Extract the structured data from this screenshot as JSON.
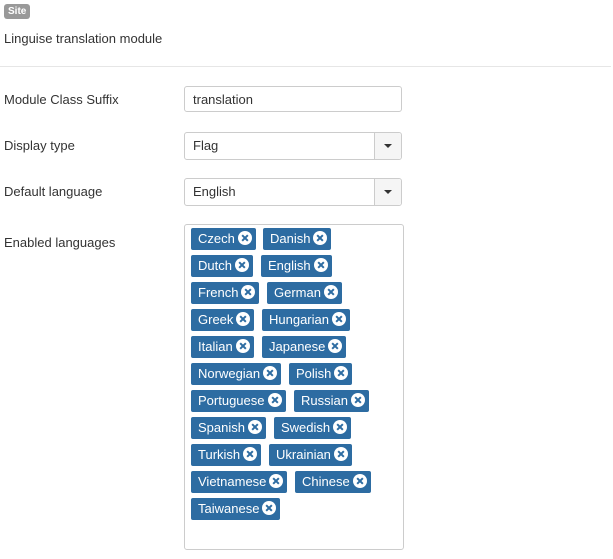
{
  "module": {
    "badge": "Site",
    "description": "Linguise translation module"
  },
  "form": {
    "class_suffix": {
      "label": "Module Class Suffix",
      "value": "translation"
    },
    "display_type": {
      "label": "Display type",
      "value": "Flag"
    },
    "default_language": {
      "label": "Default language",
      "value": "English"
    },
    "enabled_languages": {
      "label": "Enabled languages",
      "items": [
        "Czech",
        "Danish",
        "Dutch",
        "English",
        "French",
        "German",
        "Greek",
        "Hungarian",
        "Italian",
        "Japanese",
        "Norwegian",
        "Polish",
        "Portuguese",
        "Russian",
        "Spanish",
        "Swedish",
        "Turkish",
        "Ukrainian",
        "Vietnamese",
        "Chinese",
        "Taiwanese"
      ]
    }
  },
  "colors": {
    "chip_background": "#2d6ca2",
    "badge_background": "#999999"
  },
  "icons": {
    "select_toggle": "caret-down-icon",
    "chip_remove": "circle-x-icon"
  }
}
